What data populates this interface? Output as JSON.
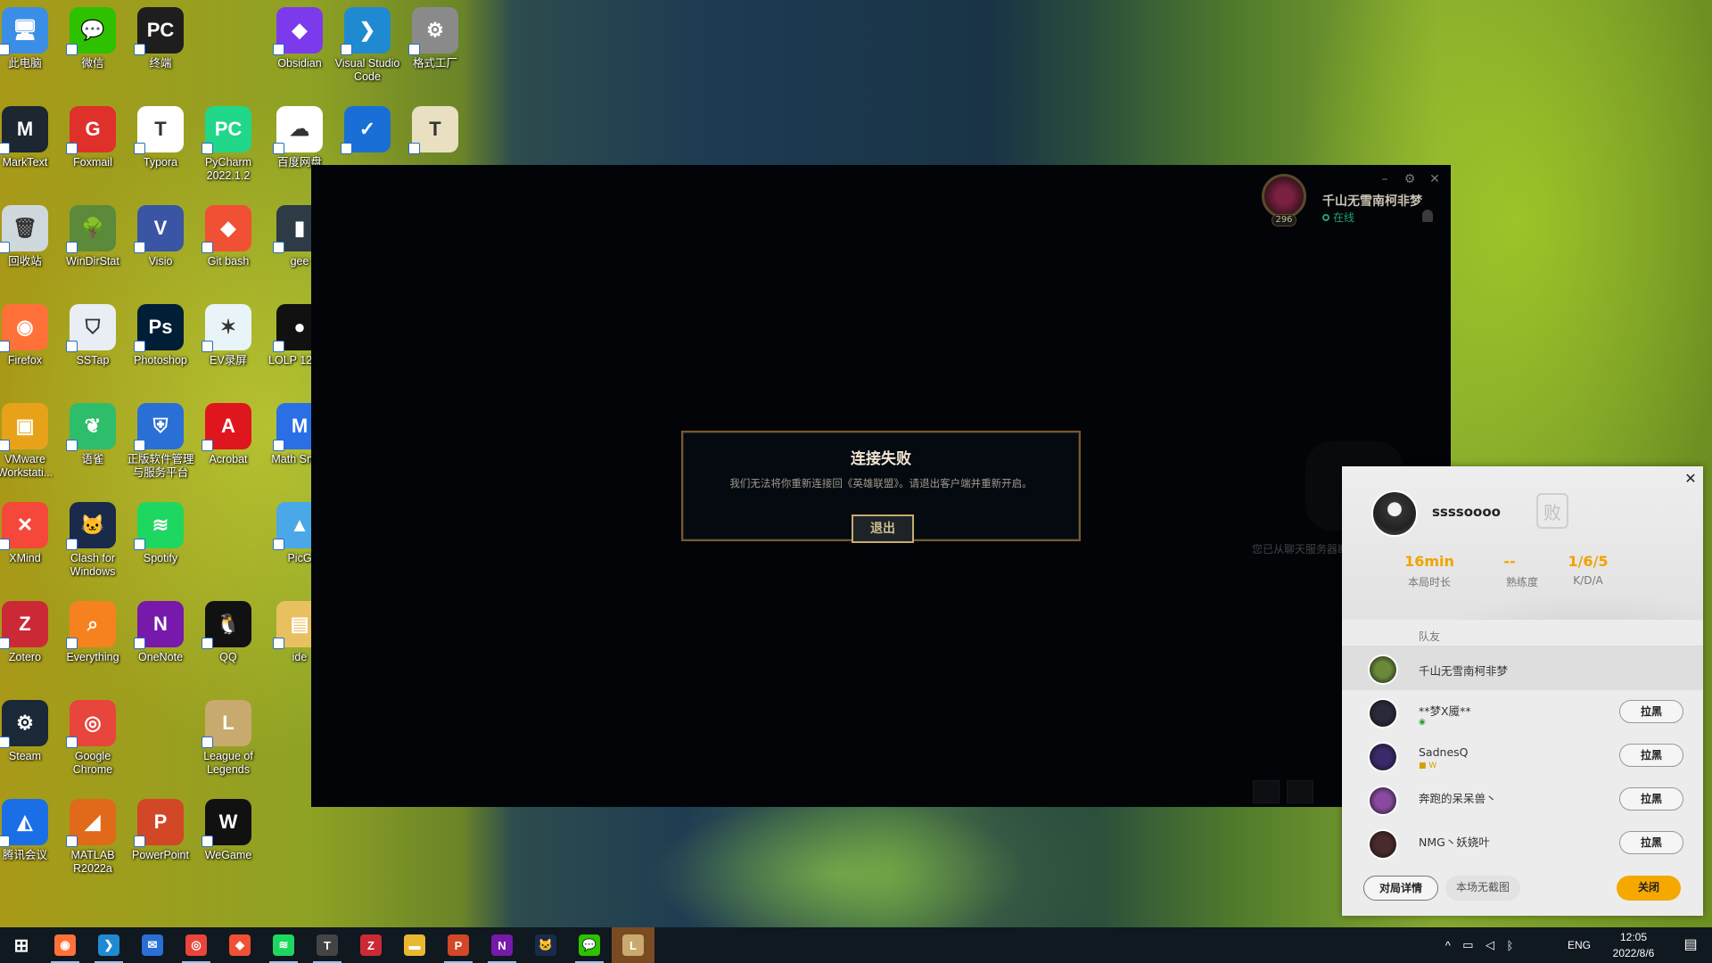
{
  "desktop": {
    "icons": [
      {
        "label": "此电脑",
        "color": "#3a8ee6",
        "glyph": "🖥"
      },
      {
        "label": "微信",
        "color": "#2dc100",
        "glyph": "💬"
      },
      {
        "label": "终端",
        "color": "#1e1e1e",
        "glyph": "PC"
      },
      {
        "label": "Obsidian",
        "color": "#7c3aed",
        "glyph": "◆"
      },
      {
        "label": "Visual Studio Code",
        "color": "#1f8ad2",
        "glyph": "❯"
      },
      {
        "label": "格式工厂",
        "color": "#8a8a8a",
        "glyph": "⚙"
      },
      {
        "label": "MarkText",
        "color": "#1c2732",
        "glyph": "M"
      },
      {
        "label": "Foxmail",
        "color": "#e0302a",
        "glyph": "G"
      },
      {
        "label": "Typora",
        "color": "#ffffff",
        "glyph": "T"
      },
      {
        "label": "PyCharm 2022.1.2",
        "color": "#21d789",
        "glyph": "PC"
      },
      {
        "label": "百度网盘",
        "color": "#ffffff",
        "glyph": "☁"
      },
      {
        "label": "",
        "color": "#1a6fd6",
        "glyph": "✓"
      },
      {
        "label": "",
        "color": "#e8e0c0",
        "glyph": "T"
      },
      {
        "label": "回收站",
        "color": "#cfd8dc",
        "glyph": "🗑"
      },
      {
        "label": "WinDirStat",
        "color": "#5a8a3a",
        "glyph": "🌳"
      },
      {
        "label": "Visio",
        "color": "#3955a3",
        "glyph": "V"
      },
      {
        "label": "Git bash",
        "color": "#f05033",
        "glyph": "◆"
      },
      {
        "label": "gee",
        "color": "#2e3a46",
        "glyph": "▮"
      },
      {
        "label": "Firefox",
        "color": "#ff7139",
        "glyph": "◉"
      },
      {
        "label": "SSTap",
        "color": "#e8eef4",
        "glyph": "⛉"
      },
      {
        "label": "Photoshop",
        "color": "#001e36",
        "glyph": "Ps"
      },
      {
        "label": "EV录屏",
        "color": "#e8f4f8",
        "glyph": "✶"
      },
      {
        "label": "LOLP 12.14.",
        "color": "#111111",
        "glyph": "●"
      },
      {
        "label": "VMware Workstati...",
        "color": "#e8a21a",
        "glyph": "▣"
      },
      {
        "label": "语雀",
        "color": "#2ebd6a",
        "glyph": "❦"
      },
      {
        "label": "正版软件管理与服务平台",
        "color": "#2a6fd6",
        "glyph": "⛨"
      },
      {
        "label": "Acrobat",
        "color": "#e0161e",
        "glyph": "A"
      },
      {
        "label": "Math Snipp",
        "color": "#2a6fe6",
        "glyph": "M"
      },
      {
        "label": "XMind",
        "color": "#f5473a",
        "glyph": "✕"
      },
      {
        "label": "Clash for Windows",
        "color": "#1a2a4a",
        "glyph": "🐱"
      },
      {
        "label": "Spotify",
        "color": "#1ed760",
        "glyph": "≋"
      },
      {
        "label": "PicG",
        "color": "#4aa8e8",
        "glyph": "▲"
      },
      {
        "label": "Zotero",
        "color": "#cc2936",
        "glyph": "Z"
      },
      {
        "label": "Everything",
        "color": "#f5821f",
        "glyph": "⌕"
      },
      {
        "label": "OneNote",
        "color": "#7719aa",
        "glyph": "N"
      },
      {
        "label": "QQ",
        "color": "#111111",
        "glyph": "🐧"
      },
      {
        "label": "ide",
        "color": "#e8c060",
        "glyph": "▤"
      },
      {
        "label": "Steam",
        "color": "#1b2838",
        "glyph": "⚙"
      },
      {
        "label": "Google Chrome",
        "color": "#e8453c",
        "glyph": "◎"
      },
      {
        "label": "League of Legends",
        "color": "#c8aa6e",
        "glyph": "L"
      },
      {
        "label": "腾讯会议",
        "color": "#1a6fe6",
        "glyph": "◭"
      },
      {
        "label": "MATLAB R2022a",
        "color": "#e06a1a",
        "glyph": "◢"
      },
      {
        "label": "PowerPoint",
        "color": "#d24726",
        "glyph": "P"
      },
      {
        "label": "WeGame",
        "color": "#111111",
        "glyph": "W"
      }
    ]
  },
  "client": {
    "summoner_name": "千山无雪南柯非梦",
    "level": "296",
    "status": "在线",
    "controls": {
      "minimize": "–",
      "settings": "⚙",
      "close": "✕"
    },
    "friends_notice": "您已从聊天服务器断开，重新连接"
  },
  "dialog": {
    "title": "连接失败",
    "message": "我们无法将你重新连接回《英雄联盟》。请退出客户端并重新开启。",
    "quit_label": "退出"
  },
  "result_card": {
    "close": "✕",
    "player_name": "ssssoooo",
    "result_badge": "败",
    "stats": [
      {
        "value": "16min",
        "label": "本局时长"
      },
      {
        "value": "--",
        "label": "熟练度"
      },
      {
        "value": "1/6/5",
        "label": "K/D/A"
      }
    ],
    "team_header": "队友",
    "teammates": [
      {
        "name": "千山无雪南柯非梦",
        "badge": "",
        "button": "",
        "avatar_color": "#6a8a3a"
      },
      {
        "name": "**梦X魇**",
        "badge": "◉",
        "button": "拉黑",
        "avatar_color": "#2a2a3a"
      },
      {
        "name": "SadnesQ",
        "badge": "■ W",
        "button": "拉黑",
        "avatar_color": "#3a2a6a"
      },
      {
        "name": "奔跑的呆呆兽丶",
        "badge": "",
        "button": "拉黑",
        "avatar_color": "#8a4aa0"
      },
      {
        "name": "NMG丶妖娆叶",
        "badge": "",
        "button": "拉黑",
        "avatar_color": "#4a2a2a"
      }
    ],
    "footer": {
      "details_label": "对局详情",
      "no_screenshot_label": "本场无截图",
      "close_label": "关闭"
    }
  },
  "taskbar": {
    "apps": [
      {
        "name": "start",
        "glyph": "⊞",
        "color": "transparent"
      },
      {
        "name": "firefox",
        "glyph": "◉",
        "color": "#ff7139"
      },
      {
        "name": "vscode",
        "glyph": "❯",
        "color": "#1f8ad2"
      },
      {
        "name": "mail",
        "glyph": "✉",
        "color": "#2a6fd6"
      },
      {
        "name": "chrome",
        "glyph": "◎",
        "color": "#e8453c"
      },
      {
        "name": "git",
        "glyph": "◆",
        "color": "#f05033"
      },
      {
        "name": "spotify",
        "glyph": "≋",
        "color": "#1ed760"
      },
      {
        "name": "typora",
        "glyph": "T",
        "color": "#444444"
      },
      {
        "name": "zotero",
        "glyph": "Z",
        "color": "#cc2936"
      },
      {
        "name": "explorer",
        "glyph": "▬",
        "color": "#e8b830"
      },
      {
        "name": "powerpoint",
        "glyph": "P",
        "color": "#d24726"
      },
      {
        "name": "onenote",
        "glyph": "N",
        "color": "#7719aa"
      },
      {
        "name": "clash",
        "glyph": "🐱",
        "color": "#1a2a4a"
      },
      {
        "name": "wechat",
        "glyph": "💬",
        "color": "#2dc100"
      },
      {
        "name": "league",
        "glyph": "L",
        "color": "#c8aa6e"
      }
    ],
    "tray": {
      "language": "ENG",
      "time": "12:05",
      "date": "2022/8/6"
    }
  }
}
